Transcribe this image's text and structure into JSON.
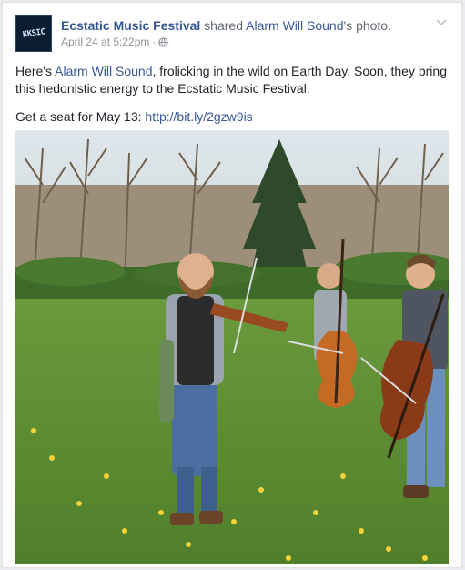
{
  "post": {
    "page_name": "Ecstatic Music Festival",
    "shared_text": " shared ",
    "original_author": "Alarm Will Sound",
    "photo_suffix": "'s photo.",
    "timestamp": "April 24 at 5:22pm",
    "separator": " · ",
    "privacy_icon": "globe-icon",
    "menu_icon": "chevron-down-icon",
    "avatar_text": "KKSIC",
    "body": {
      "p1_prefix": "Here's ",
      "p1_link": "Alarm Will Sound",
      "p1_suffix": ", frolicking in the wild on Earth Day. Soon, they bring this hedonistic energy to the Ecstatic Music Festival.",
      "p2_prefix": "Get a seat for May 13: ",
      "p2_link": "http://bit.ly/2gzw9is"
    }
  },
  "colors": {
    "link": "#365899",
    "meta": "#90949c",
    "text": "#1d2129"
  }
}
